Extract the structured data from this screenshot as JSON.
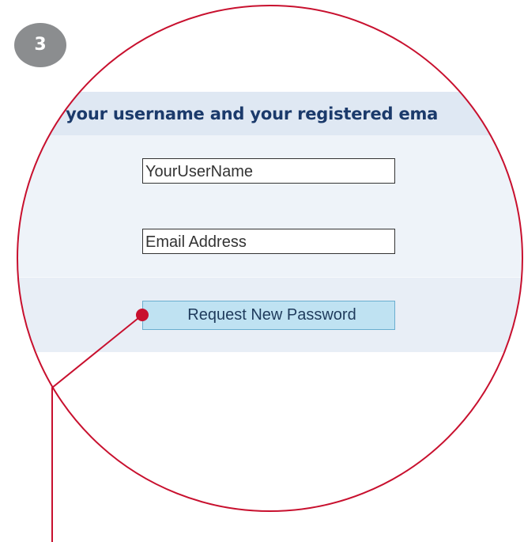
{
  "step": {
    "number": "3"
  },
  "header": {
    "text": "ter your username and your registered ema"
  },
  "form": {
    "username": {
      "value": "YourUserName"
    },
    "email": {
      "value": "Email Address"
    },
    "submit_label": "Request New Password"
  },
  "colors": {
    "callout": "#c8102e",
    "badge": "#8b8d8f",
    "header_text": "#1b3a6b",
    "button_fill": "#bfe2f2"
  }
}
